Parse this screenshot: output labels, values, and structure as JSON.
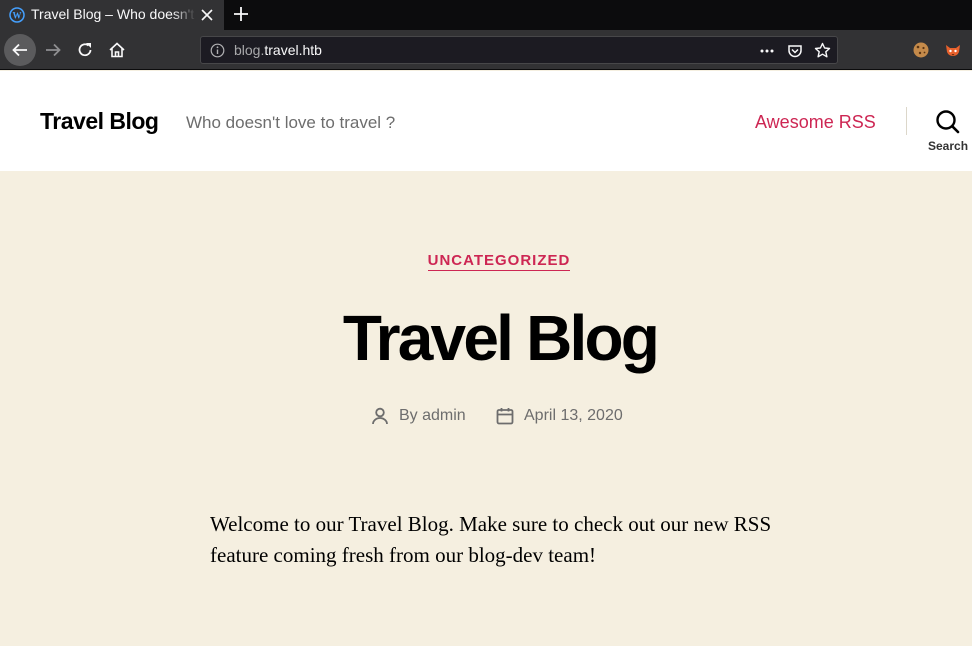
{
  "browser": {
    "tab_title": "Travel Blog – Who doesn't love to travel ?",
    "url_dim": "blog.",
    "url_main": "travel.htb",
    "colors": {
      "chrome_dark": "#0c0c0d",
      "chrome": "#323234",
      "urlbar": "#1c1b22"
    }
  },
  "site": {
    "title": "Travel Blog",
    "description": "Who doesn't love to travel ?",
    "nav": [
      {
        "label": "Awesome RSS"
      }
    ],
    "search_label": "Search",
    "colors": {
      "accent": "#cd2653",
      "hero_bg": "#f5efe0",
      "header_bg": "#ffffff"
    }
  },
  "post": {
    "category": "UNCATEGORIZED",
    "title": "Travel Blog",
    "author_prefix": "By",
    "author": "admin",
    "date": "April 13, 2020",
    "body": "Welcome to our Travel Blog. Make sure to check out our new RSS feature coming fresh from our blog-dev team!"
  }
}
